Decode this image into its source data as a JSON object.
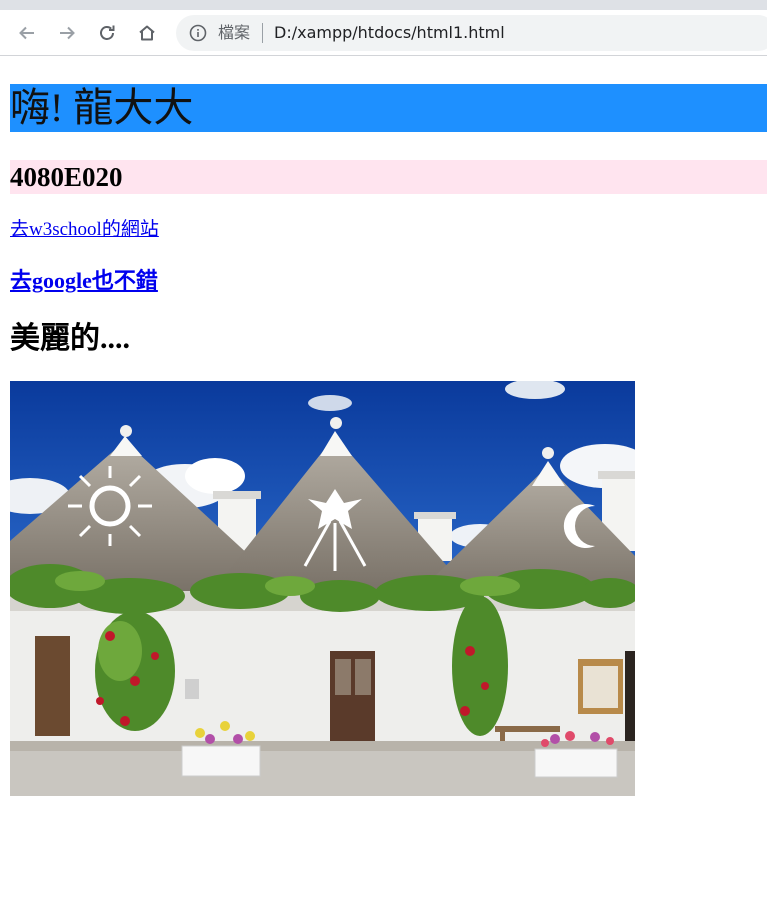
{
  "browser": {
    "site_info_label": "檔案",
    "url": "D:/xampp/htdocs/html1.html",
    "nav_icons": [
      "back-icon",
      "forward-icon",
      "reload-icon",
      "home-icon"
    ]
  },
  "page": {
    "heading1": "嗨! 龍大大",
    "heading1_bg": "#1e90ff",
    "heading2": "4080E020",
    "heading2_bg": "#ffe4ef",
    "link_w3school": "去w3school的網站",
    "link_google": "去google也不錯",
    "subheading": "美麗的....",
    "link_color": "#0000ee"
  }
}
